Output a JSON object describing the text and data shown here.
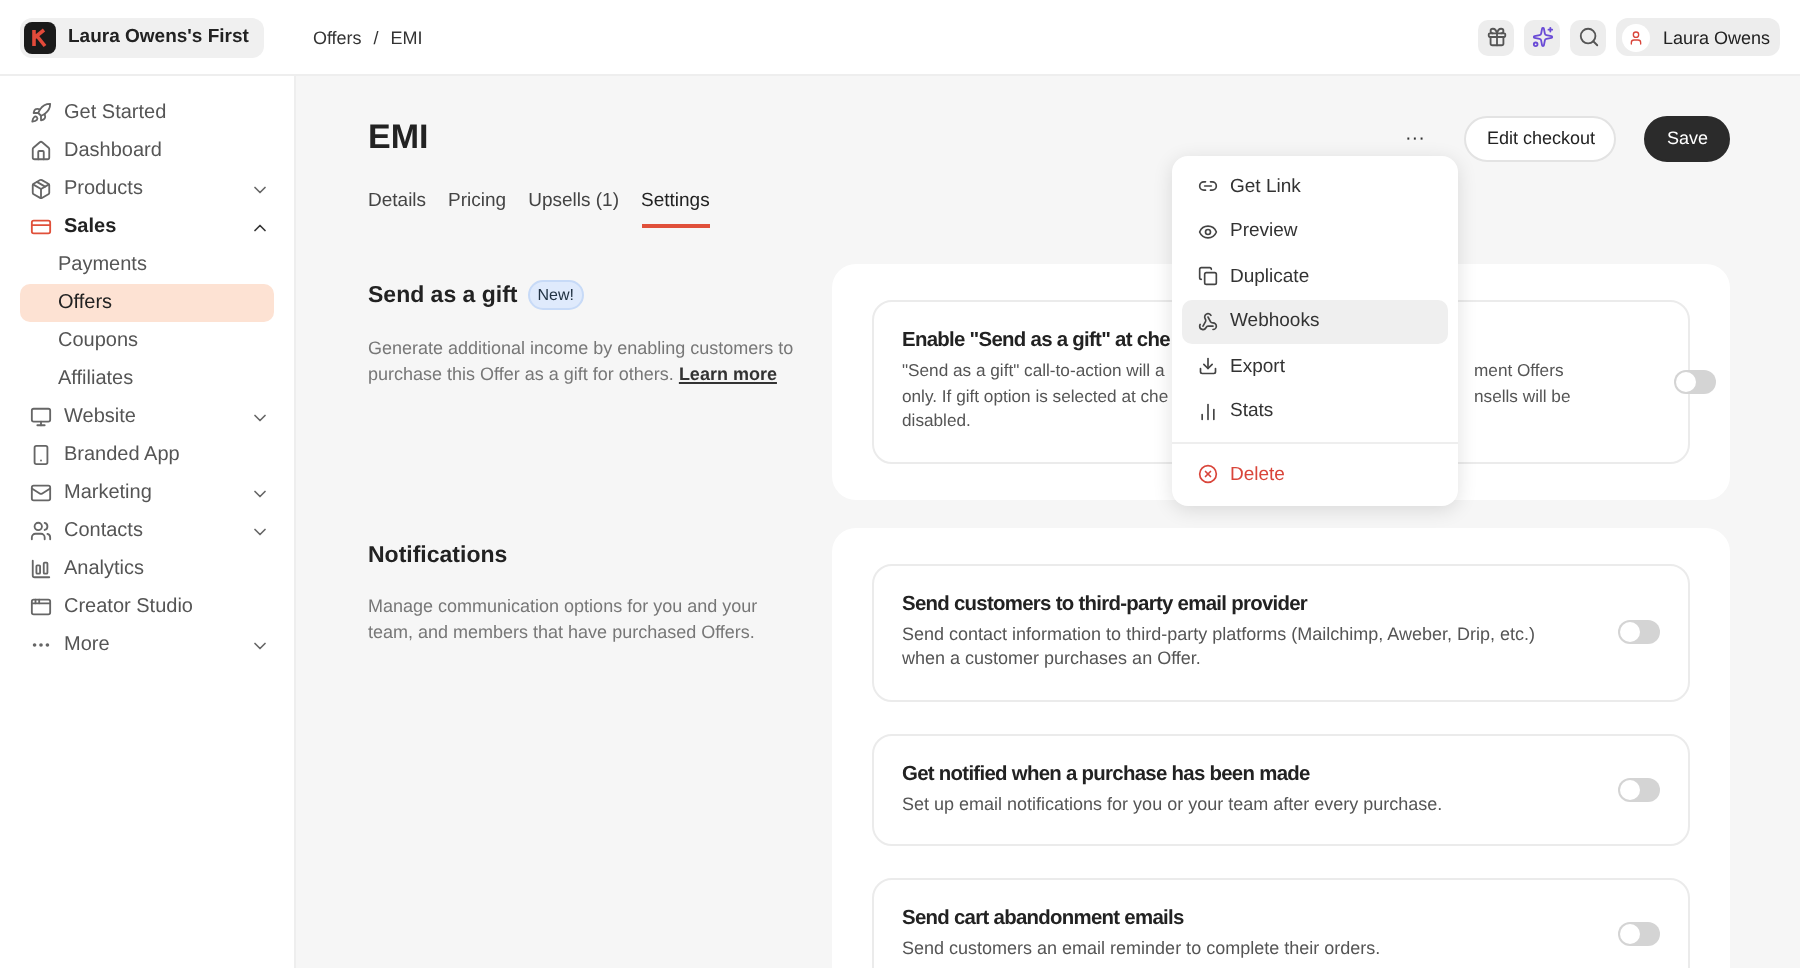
{
  "topbar": {
    "brand": "Laura Owens's First",
    "breadcrumb": [
      "Offers",
      "/",
      "EMI"
    ],
    "user": "Laura Owens"
  },
  "sidebar": {
    "items": [
      {
        "label": "Get Started",
        "selected": false
      },
      {
        "label": "Dashboard",
        "selected": false
      },
      {
        "label": "Products",
        "selected": false,
        "expanded": false
      },
      {
        "label": "Sales",
        "selected": true,
        "expanded": true,
        "children": [
          {
            "label": "Payments",
            "selected": false
          },
          {
            "label": "Offers",
            "selected": true
          },
          {
            "label": "Coupons",
            "selected": false
          },
          {
            "label": "Affiliates",
            "selected": false
          }
        ]
      },
      {
        "label": "Website",
        "selected": false,
        "expanded": false
      },
      {
        "label": "Branded App",
        "selected": false
      },
      {
        "label": "Marketing",
        "selected": false,
        "expanded": false
      },
      {
        "label": "Contacts",
        "selected": false,
        "expanded": false
      },
      {
        "label": "Analytics",
        "selected": false
      },
      {
        "label": "Creator Studio",
        "selected": false
      },
      {
        "label": "More",
        "selected": false,
        "expanded": false
      }
    ]
  },
  "page": {
    "title": "EMI",
    "more": "···",
    "buttons": [
      {
        "label": "Edit checkout",
        "kind": "secondary"
      },
      {
        "label": "Save",
        "kind": "primary"
      }
    ],
    "tabs": [
      {
        "label": "Details",
        "selected": false
      },
      {
        "label": "Pricing",
        "selected": false
      },
      {
        "label": "Upsells (1)",
        "selected": false
      },
      {
        "label": "Settings",
        "selected": true
      }
    ]
  },
  "menu": {
    "items": [
      {
        "label": "Get Link",
        "kind": "normal",
        "selected": false
      },
      {
        "label": "Preview",
        "kind": "normal",
        "selected": false
      },
      {
        "label": "Duplicate",
        "kind": "normal",
        "selected": false
      },
      {
        "label": "Webhooks",
        "kind": "normal",
        "selected": true
      },
      {
        "label": "Export",
        "kind": "normal",
        "selected": false
      },
      {
        "label": "Stats",
        "kind": "normal",
        "selected": false
      },
      {
        "label": "Delete",
        "kind": "danger",
        "selected": false
      }
    ]
  },
  "sections": [
    {
      "title": "Send as a gift",
      "badge": "New!",
      "description": "Generate additional income by enabling customers to purchase this Offer as a gift for others.",
      "link": "Learn more",
      "cards": [
        {
          "title": "Enable \"Send as a gift\" at che",
          "description_left": [
            "\"Send as a gift\" call-to-action will a",
            "only. If gift option is selected at che",
            "disabled."
          ],
          "description_right": [
            "ment Offers",
            "nsells will be"
          ],
          "on": false
        }
      ]
    },
    {
      "title": "Notifications",
      "description": "Manage communication options for you and your team, and members that have purchased Offers.",
      "cards": [
        {
          "title": "Send customers to third-party email provider",
          "description": "Send contact information to third-party platforms (Mailchimp, Aweber, Drip, etc.) when a customer purchases an Offer.",
          "on": false
        },
        {
          "title": "Get notified when a purchase has been made",
          "description": "Set up email notifications for you or your team after every purchase.",
          "on": false
        },
        {
          "title": "Send cart abandonment emails",
          "description": "Send customers an email reminder to complete their orders.",
          "on": false
        }
      ]
    }
  ]
}
